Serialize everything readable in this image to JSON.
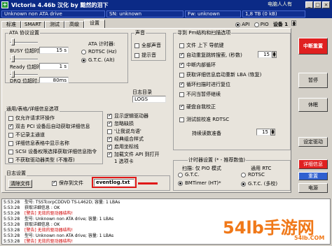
{
  "window": {
    "title": "Victoria 4.46b 汉化 by 黯然的泪下",
    "watermark": "电脑人人有",
    "min": "_",
    "max": "□",
    "close": "×"
  },
  "infobar": {
    "drive": "Unknown non ATA drive",
    "sn": "SN: unknown",
    "fw": "Fw: unknown",
    "size": "1,8 TB (0 kB)"
  },
  "tabs": [
    "标准",
    "SMART",
    "测试",
    "高级",
    "设置"
  ],
  "mode": {
    "api": "API",
    "pio": "PIO",
    "device": "设备 1"
  },
  "ata": {
    "title": "ATA 协议设置",
    "busy_label": "BUSY 位超时:",
    "busy_value": "15 s",
    "ready_label": "Ready 位超时:",
    "ready_value": "1 s",
    "drq_label": "DRQ 位超时:",
    "drq_value": "80ms",
    "timer_label": "ATA 计时器:",
    "timer_rdtsc": "RDTSC",
    "timer_rdtsc_sub": "(Hz)",
    "timer_gtc": "G.T.C.",
    "timer_gtc_sub": "(Alt)"
  },
  "sound": {
    "title": "声音",
    "all": "全部声音",
    "beep": "提示音"
  },
  "logdir": {
    "title": "日志目录",
    "value": "LOGS"
  },
  "general": {
    "title": "通用/表格/详细信息选项",
    "items": [
      "仅允许请求环操作",
      "双击 PCI 设备后自动获取详细信息",
      "不记录主通道",
      "详细信息表格中显示名称",
      "SCSI 设备权限选择获取详细信息指令",
      "不获取驱动器类型 (不推荐)"
    ],
    "checks": [
      false,
      true,
      false,
      false,
      false,
      false
    ]
  },
  "extra": {
    "items": [
      "显示逻辑驱动器",
      "忽略缺损",
      "'让我说鸟语'",
      "经典组合样式",
      "启用坐标线",
      "加载文件 API 到打开",
      "1 选项卡"
    ],
    "checks": [
      true,
      true,
      false,
      true,
      true,
      true,
      false
    ]
  },
  "logsettings": {
    "title": "日志设置",
    "clear": "清除文件",
    "save_label": "保存到文件",
    "file": "eventlog.txt"
  },
  "scan": {
    "title": "寻到 Pm结构和扫描选项",
    "items": [
      "文件 上下 导航键",
      "自动重复跳转搜索,  (秒数)",
      "中断内部循环",
      "获取详细信息启动重新 LBA (恢复)",
      "循环扫描时进行复位",
      "不问当暂停继续",
      "硬盘自我校正",
      "测试前校准 RDTSC"
    ],
    "checks": [
      false,
      true,
      true,
      false,
      true,
      false,
      true,
      false
    ],
    "delay": "15",
    "pause_label": "持续读数准备",
    "pause_value": "15"
  },
  "timer2": {
    "title": "计时器设置 (* - 推荐数值)",
    "scan_label": "扫描: 仅 PIO 模式",
    "api_label": "通用 RTC",
    "gtc": "G.T.C.",
    "gtc2": "G.T.C. (多校)",
    "rdtsc": "RDTSC",
    "bmtimer": "BMTimer (HT)*"
  },
  "side": {
    "interrupt": "中断重置",
    "pause": "暂停",
    "break": "休眠",
    "drive_params": "设定驱动",
    "info": "详细信息",
    "reset": "重置",
    "power": "电源"
  },
  "log": [
    {
      "t": "5:53:28",
      "txt": "型号:  TSSTcorpCDDVD TS-L462D;    容量:  1 LBAs",
      "err": false
    },
    {
      "t": "5:53:28",
      "txt": "获取详细信息  :  OK",
      "err": false
    },
    {
      "t": "5:53:28",
      "txt": "[警告] 无效的驱动器结构!",
      "err": true
    },
    {
      "t": "5:53:28",
      "txt": "型号:  Unknown non ATA drive;     容量:  1 LBAs",
      "err": false
    },
    {
      "t": "5:53:28",
      "txt": "获取详细信息  :  OK",
      "err": false
    },
    {
      "t": "5:53:28",
      "txt": "[警告] 无效的驱动器结构!",
      "err": true
    },
    {
      "t": "5:53:28",
      "txt": "型号:  Unknown non ATA drive;     容量:  1 LBAs",
      "err": false
    },
    {
      "t": "5:53:28",
      "txt": "[警告] 无效的驱动器结构!",
      "err": true
    }
  ],
  "corner_mark": "54lb手游网",
  "corner_url": "54lb.COM"
}
